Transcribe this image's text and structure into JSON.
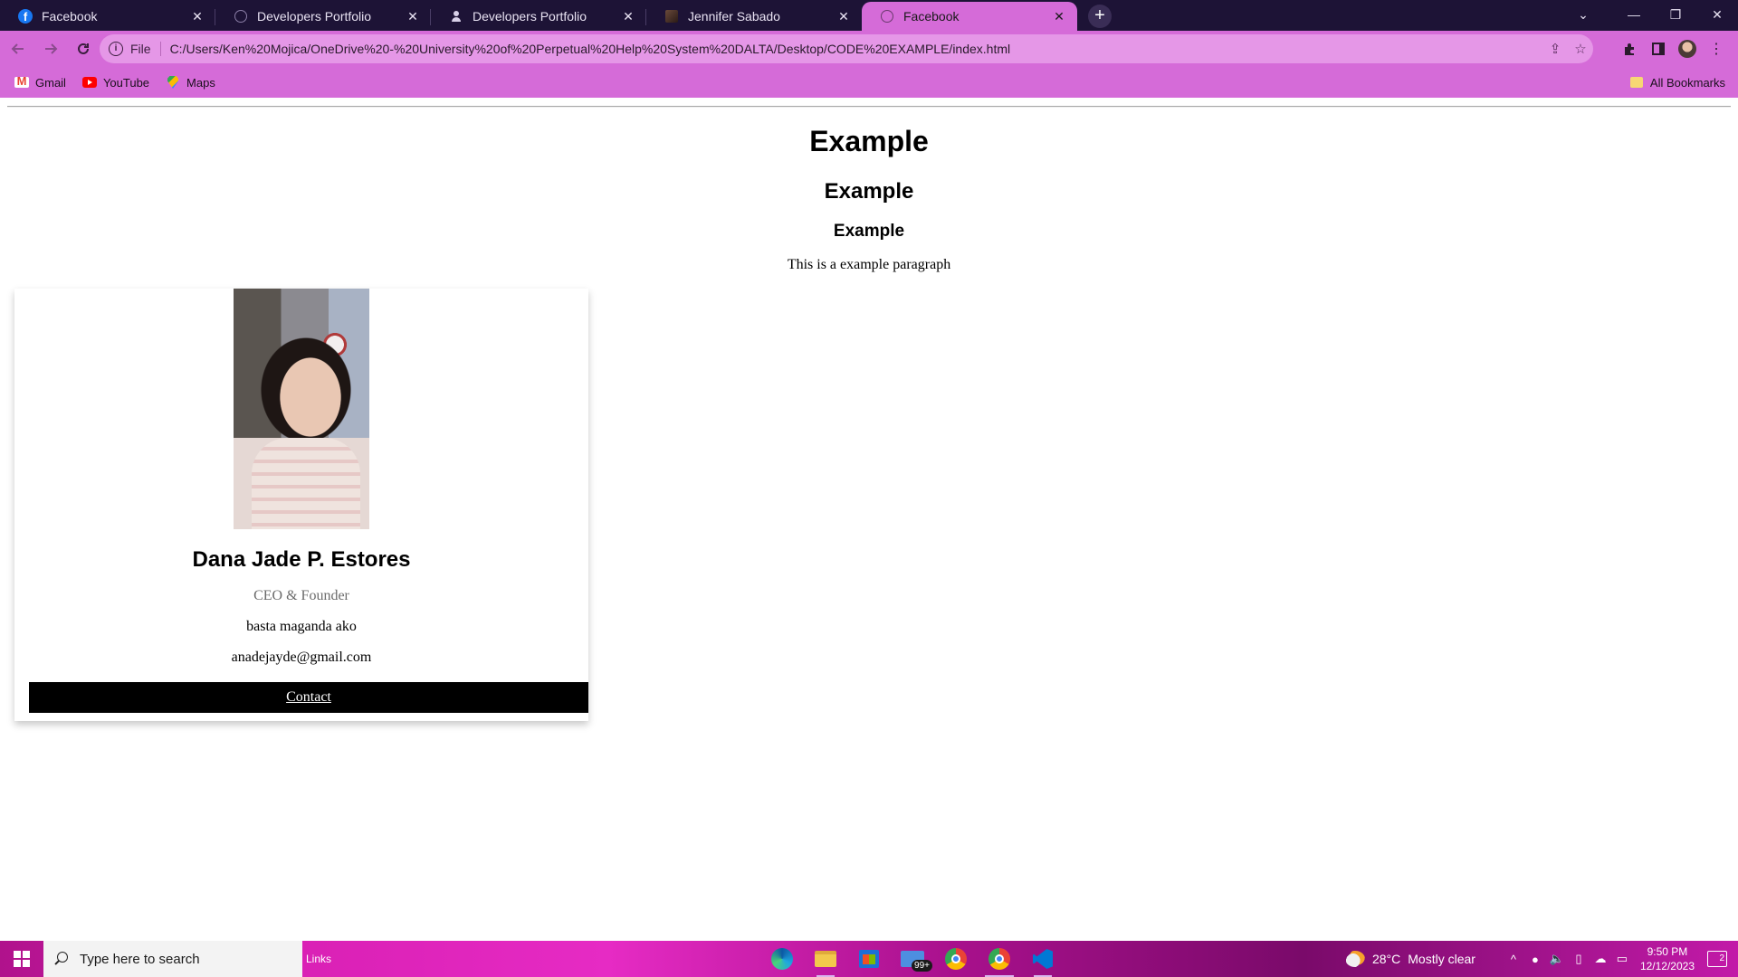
{
  "browser": {
    "tabs": [
      {
        "title": "Facebook",
        "icon": "facebook-icon",
        "active": false
      },
      {
        "title": "Developers Portfolio",
        "icon": "globe-icon",
        "active": false
      },
      {
        "title": "Developers Portfolio",
        "icon": "person-icon",
        "active": false
      },
      {
        "title": "Jennifer Sabado",
        "icon": "photo-icon",
        "active": false
      },
      {
        "title": "Facebook",
        "icon": "globe-icon",
        "active": true
      }
    ],
    "tab_close_glyph": "✕",
    "new_tab_glyph": "+",
    "window_controls": {
      "minimize": "—",
      "restore": "❐",
      "close": "✕"
    },
    "tab_search_glyph": "⌄",
    "address": {
      "scheme_label": "File",
      "url": "C:/Users/Ken%20Mojica/OneDrive%20-%20University%20of%20Perpetual%20Help%20System%20DALTA/Desktop/CODE%20EXAMPLE/index.html"
    },
    "bookmarks": [
      {
        "label": "Gmail",
        "icon": "gmail-icon"
      },
      {
        "label": "YouTube",
        "icon": "youtube-icon"
      },
      {
        "label": "Maps",
        "icon": "maps-icon"
      }
    ],
    "all_bookmarks_label": "All Bookmarks"
  },
  "page": {
    "heading1": "Example",
    "heading2": "Example",
    "heading3": "Example",
    "paragraph": "This is a example paragraph",
    "card": {
      "name": "Dana Jade P. Estores",
      "title": "CEO & Founder",
      "bio": "basta maganda ako",
      "email": "anadejayde@gmail.com",
      "contact_label": "Contact"
    }
  },
  "taskbar": {
    "search_placeholder": "Type here to search",
    "links_label": "Links",
    "mail_badge": "99+",
    "temperature": "28°C",
    "weather": "Mostly clear",
    "time": "9:50 PM",
    "date": "12/12/2023",
    "notification_count": "2"
  },
  "colors": {
    "tab_strip": "#1d1336",
    "toolbar_accent": "#d56bd8",
    "contact_button": "#000000"
  }
}
